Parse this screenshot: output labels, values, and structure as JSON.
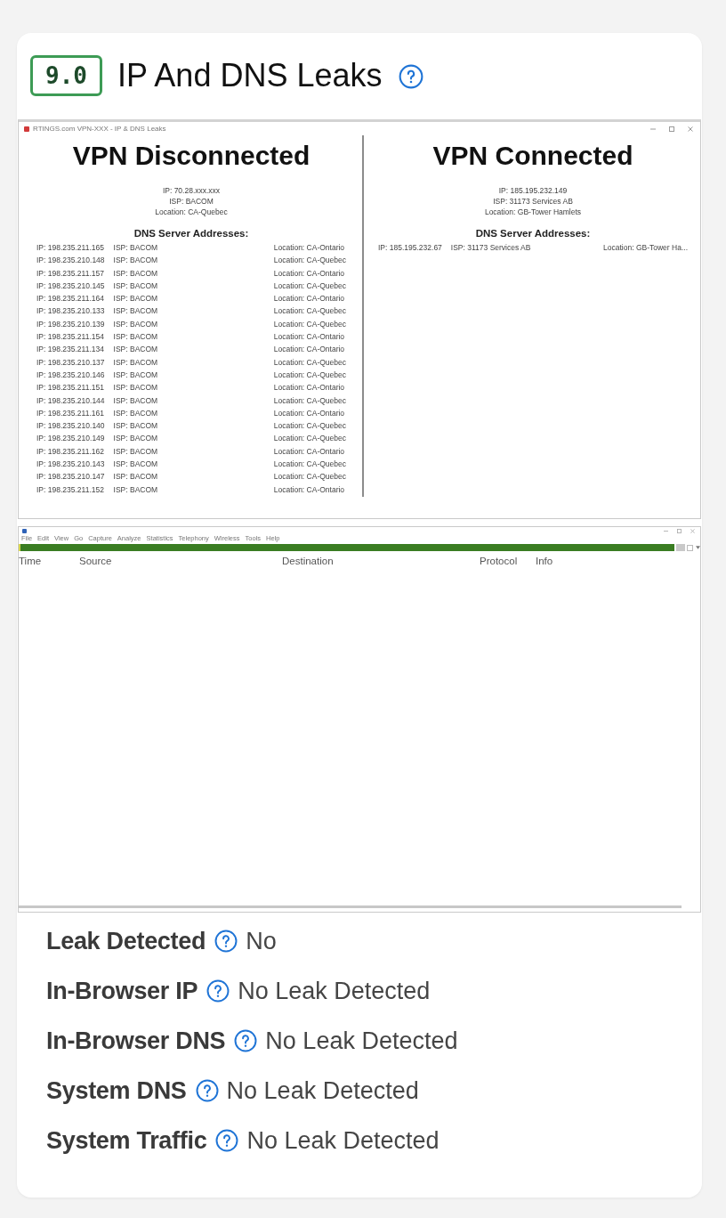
{
  "header": {
    "score": "9.0",
    "title": "IP And DNS Leaks"
  },
  "screenshots": [
    {
      "kind": "leak-test",
      "window_title": "RTINGS.com VPN-XXX - IP & DNS Leaks",
      "panes": [
        {
          "heading": "VPN Disconnected",
          "details": [
            "IP: 70.28.xxx.xxx",
            "ISP: BACOM",
            "Location: CA-Quebec"
          ],
          "dns_heading": "DNS Server Addresses:",
          "dns_servers": [
            {
              "ip": "IP: 198.235.211.165",
              "isp": "ISP: BACOM",
              "location": "Location: CA-Ontario"
            },
            {
              "ip": "IP: 198.235.210.148",
              "isp": "ISP: BACOM",
              "location": "Location: CA-Quebec"
            },
            {
              "ip": "IP: 198.235.211.157",
              "isp": "ISP: BACOM",
              "location": "Location: CA-Ontario"
            },
            {
              "ip": "IP: 198.235.210.145",
              "isp": "ISP: BACOM",
              "location": "Location: CA-Quebec"
            },
            {
              "ip": "IP: 198.235.211.164",
              "isp": "ISP: BACOM",
              "location": "Location: CA-Ontario"
            },
            {
              "ip": "IP: 198.235.210.133",
              "isp": "ISP: BACOM",
              "location": "Location: CA-Quebec"
            },
            {
              "ip": "IP: 198.235.210.139",
              "isp": "ISP: BACOM",
              "location": "Location: CA-Quebec"
            },
            {
              "ip": "IP: 198.235.211.154",
              "isp": "ISP: BACOM",
              "location": "Location: CA-Ontario"
            },
            {
              "ip": "IP: 198.235.211.134",
              "isp": "ISP: BACOM",
              "location": "Location: CA-Ontario"
            },
            {
              "ip": "IP: 198.235.210.137",
              "isp": "ISP: BACOM",
              "location": "Location: CA-Quebec"
            },
            {
              "ip": "IP: 198.235.210.146",
              "isp": "ISP: BACOM",
              "location": "Location: CA-Quebec"
            },
            {
              "ip": "IP: 198.235.211.151",
              "isp": "ISP: BACOM",
              "location": "Location: CA-Ontario"
            },
            {
              "ip": "IP: 198.235.210.144",
              "isp": "ISP: BACOM",
              "location": "Location: CA-Quebec"
            },
            {
              "ip": "IP: 198.235.211.161",
              "isp": "ISP: BACOM",
              "location": "Location: CA-Ontario"
            },
            {
              "ip": "IP: 198.235.210.140",
              "isp": "ISP: BACOM",
              "location": "Location: CA-Quebec"
            },
            {
              "ip": "IP: 198.235.210.149",
              "isp": "ISP: BACOM",
              "location": "Location: CA-Quebec"
            },
            {
              "ip": "IP: 198.235.211.162",
              "isp": "ISP: BACOM",
              "location": "Location: CA-Ontario"
            },
            {
              "ip": "IP: 198.235.210.143",
              "isp": "ISP: BACOM",
              "location": "Location: CA-Quebec"
            },
            {
              "ip": "IP: 198.235.210.147",
              "isp": "ISP: BACOM",
              "location": "Location: CA-Quebec"
            },
            {
              "ip": "IP: 198.235.211.152",
              "isp": "ISP: BACOM",
              "location": "Location: CA-Ontario"
            }
          ]
        },
        {
          "heading": "VPN Connected",
          "details": [
            "IP: 185.195.232.149",
            "ISP: 31173 Services AB",
            "Location: GB-Tower Hamlets"
          ],
          "dns_heading": "DNS Server Addresses:",
          "dns_servers": [
            {
              "ip": "IP: 185.195.232.67",
              "isp": "ISP: 31173 Services AB",
              "location": "Location: GB-Tower Ha..."
            }
          ]
        }
      ]
    },
    {
      "kind": "packet-capture",
      "menu": [
        "File",
        "Edit",
        "View",
        "Go",
        "Capture",
        "Analyze",
        "Statistics",
        "Telephony",
        "Wireless",
        "Tools",
        "Help"
      ],
      "columns": [
        "Time",
        "Source",
        "Destination",
        "Protocol",
        "Info"
      ]
    }
  ],
  "results": [
    {
      "label": "Leak Detected",
      "value": "No"
    },
    {
      "label": "In-Browser IP",
      "value": "No Leak Detected"
    },
    {
      "label": "In-Browser DNS",
      "value": "No Leak Detected"
    },
    {
      "label": "System DNS",
      "value": "No Leak Detected"
    },
    {
      "label": "System Traffic",
      "value": "No Leak Detected"
    }
  ]
}
